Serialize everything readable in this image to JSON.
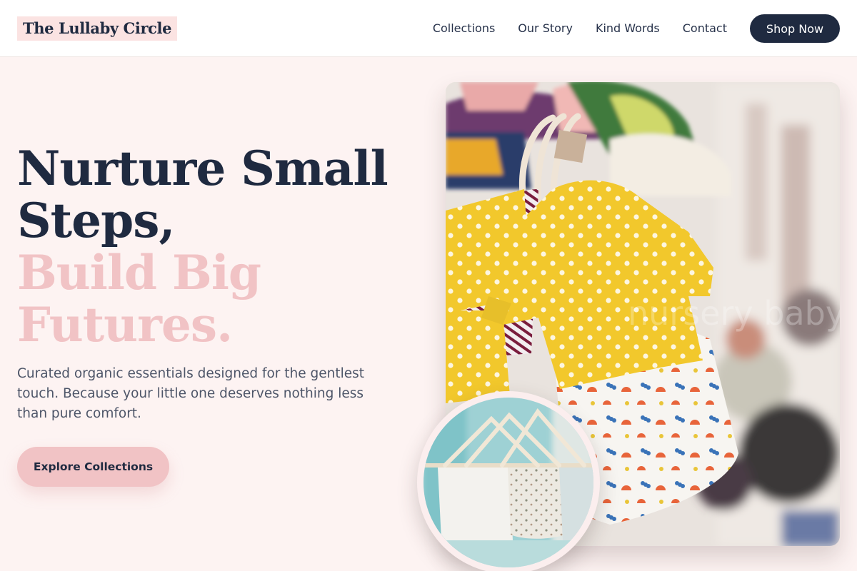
{
  "brand": {
    "name": "The Lullaby Circle"
  },
  "nav": {
    "links": [
      "Collections",
      "Our Story",
      "Kind Words",
      "Contact"
    ],
    "cta": "Shop Now"
  },
  "hero": {
    "headline_dark": [
      "Nurture Small",
      "Steps,"
    ],
    "headline_accent": [
      "Build Big",
      "Futures."
    ],
    "subtitle": "Curated organic essentials designed for the gentlest touch. Because your little one deserves nothing less than pure comfort.",
    "cta": "Explore Collections"
  },
  "images": {
    "main_photo": "baby-clothes-on-hangers-photo",
    "main_watermark": "nursery baby",
    "inset_photo": "baby-garments-hanging-photo"
  },
  "colors": {
    "navy": "#1f2a40",
    "accent_pink": "#f1c3c5",
    "background": "#fdf3f2"
  }
}
